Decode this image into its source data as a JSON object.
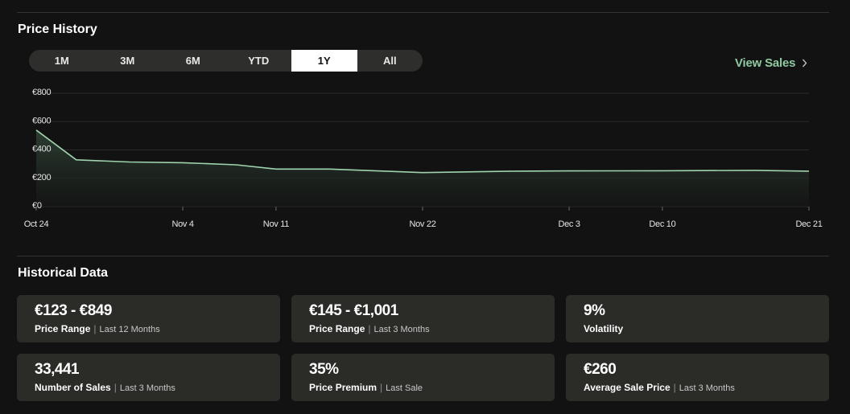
{
  "price_history": {
    "title": "Price History",
    "ranges": [
      {
        "label": "1M",
        "active": false
      },
      {
        "label": "3M",
        "active": false
      },
      {
        "label": "6M",
        "active": false
      },
      {
        "label": "YTD",
        "active": false
      },
      {
        "label": "1Y",
        "active": true
      },
      {
        "label": "All",
        "active": false
      }
    ],
    "view_sales_label": "View Sales"
  },
  "chart_data": {
    "type": "area",
    "x": [
      "Oct 24",
      "Oct 27",
      "Oct 31",
      "Nov 4",
      "Nov 8",
      "Nov 11",
      "Nov 15",
      "Nov 22",
      "Nov 29",
      "Dec 3",
      "Dec 10",
      "Dec 17",
      "Dec 21"
    ],
    "series": [
      {
        "values": [
          540,
          330,
          315,
          310,
          295,
          265,
          265,
          240,
          250,
          252,
          253,
          256,
          250
        ]
      }
    ],
    "x_tick_labels": [
      "Oct 24",
      "Nov 4",
      "Nov 11",
      "Nov 22",
      "Dec 3",
      "Dec 10",
      "Dec 21"
    ],
    "y_tick_labels": [
      "€800",
      "€600",
      "€400",
      "€200",
      "€0"
    ],
    "y_ticks": [
      800,
      600,
      400,
      200,
      0
    ],
    "ylim": [
      0,
      800
    ],
    "grid": true,
    "colors": {
      "line": "#9fd3ae",
      "fill": "#2a3a2f",
      "grid": "#2b2b2b",
      "tick": "#e6e6e6"
    }
  },
  "historical_data": {
    "title": "Historical Data",
    "stats": [
      {
        "value": "€123 - €849",
        "label": "Price Range",
        "period": "Last 12 Months"
      },
      {
        "value": "€145 - €1,001",
        "label": "Price Range",
        "period": "Last 3 Months"
      },
      {
        "value": "9%",
        "label": "Volatility",
        "period": ""
      },
      {
        "value": "33,441",
        "label": "Number of Sales",
        "period": "Last 3 Months"
      },
      {
        "value": "35%",
        "label": "Price Premium",
        "period": "Last Sale"
      },
      {
        "value": "€260",
        "label": "Average Sale Price",
        "period": "Last 3 Months"
      }
    ]
  }
}
